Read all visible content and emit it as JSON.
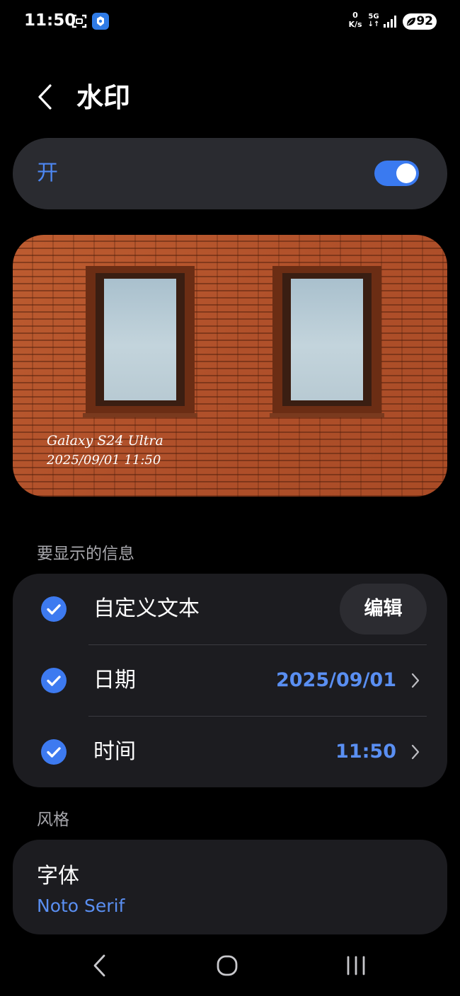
{
  "status_bar": {
    "time": "11:50",
    "net_speed_value": "0",
    "net_speed_unit": "K/s",
    "network_type": "5G",
    "battery": "92",
    "icons": [
      "screenshot-scan-icon",
      "app-notification-icon",
      "signal-icon",
      "battery-saver-leaf-icon"
    ]
  },
  "header": {
    "title": "水印",
    "back_icon": "chevron-left-icon"
  },
  "master_toggle": {
    "label": "开",
    "on": true,
    "accent": "#3a7af0"
  },
  "preview": {
    "watermark_model": "Galaxy S24 Ultra",
    "watermark_datetime": "2025/09/01 11:50"
  },
  "info_section": {
    "header": "要显示的信息",
    "rows": [
      {
        "label": "自定义文本",
        "checked": true,
        "action": "编辑"
      },
      {
        "label": "日期",
        "checked": true,
        "value": "2025/09/01"
      },
      {
        "label": "时间",
        "checked": true,
        "value": "11:50"
      }
    ]
  },
  "style_section": {
    "header": "风格",
    "font_label": "字体",
    "font_value": "Noto Serif"
  },
  "nav_bar": {
    "icons": [
      "nav-back-icon",
      "nav-home-icon",
      "nav-recents-icon"
    ]
  },
  "colors": {
    "background": "#000000",
    "card": "#1c1c20",
    "accent_blue": "#5a8ff2",
    "secondary_text": "#a8a8ad"
  }
}
